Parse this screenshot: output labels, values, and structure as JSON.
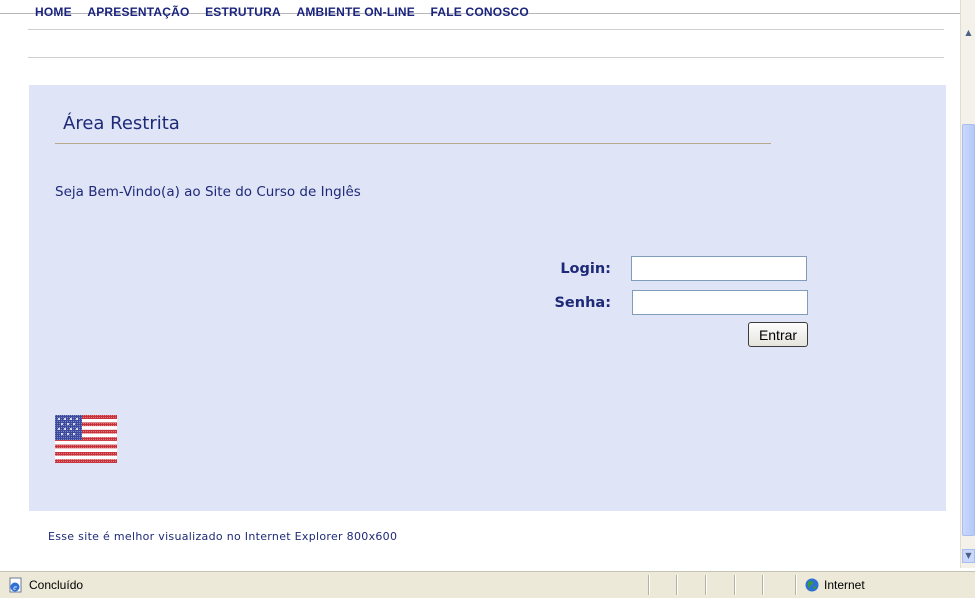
{
  "nav": {
    "items": [
      "HOME",
      "APRESENTAÇÃO",
      "ESTRUTURA",
      "AMBIENTE ON-LINE",
      "FALE CONOSCO"
    ]
  },
  "panel": {
    "title": "Área Restrita",
    "welcome": "Seja Bem-Vindo(a) ao Site do Curso de Inglês"
  },
  "login_form": {
    "login_label": "Login:",
    "login_value": "",
    "senha_label": "Senha:",
    "senha_value": "",
    "submit_label": "Entrar"
  },
  "footer": {
    "note": "Esse site é melhor visualizado no Internet Explorer 800x600"
  },
  "statusbar": {
    "status": "Concluído",
    "zone": "Internet"
  },
  "colors": {
    "panel_bg": "#dfe4f7",
    "text_navy": "#1e2a78",
    "statusbar_bg": "#ece9d8"
  },
  "icons": {
    "flag": "us-flag-icon",
    "status": "ie-page-icon",
    "zone": "globe-icon"
  }
}
